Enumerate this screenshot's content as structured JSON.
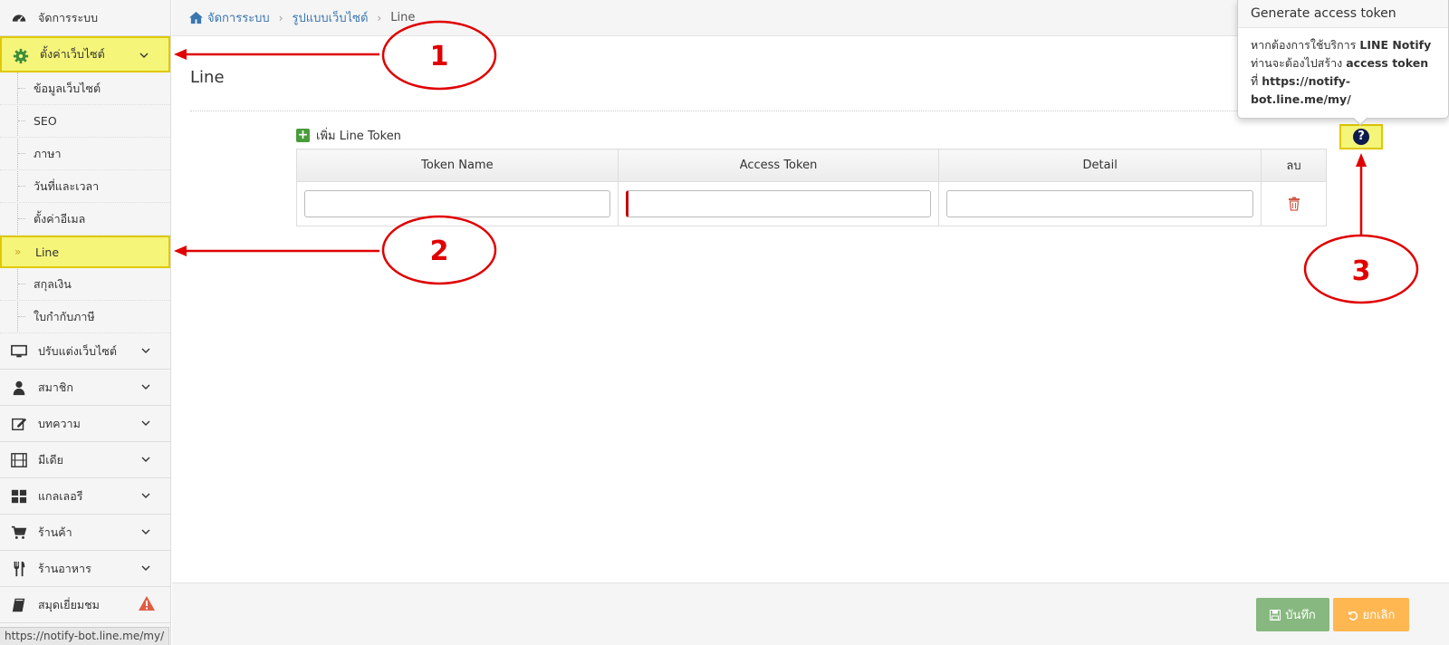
{
  "sidebar": {
    "items": [
      {
        "label": "จัดการระบบ",
        "icon": "dashboard-icon"
      },
      {
        "label": "ตั้งค่าเว็บไซต์",
        "icon": "gear-icon",
        "active": true
      },
      {
        "label": "ปรับแต่งเว็บไซต์",
        "icon": "monitor-icon"
      },
      {
        "label": "สมาชิก",
        "icon": "user-icon"
      },
      {
        "label": "บทความ",
        "icon": "edit-icon"
      },
      {
        "label": "มีเดีย",
        "icon": "film-icon"
      },
      {
        "label": "แกลเลอรี",
        "icon": "grid-icon"
      },
      {
        "label": "ร้านค้า",
        "icon": "cart-icon"
      },
      {
        "label": "ร้านอาหาร",
        "icon": "cutlery-icon"
      },
      {
        "label": "สมุดเยี่ยมชม",
        "icon": "book-icon",
        "badge": "warning-icon"
      }
    ],
    "sub_items": [
      {
        "label": "ข้อมูลเว็บไซต์"
      },
      {
        "label": "SEO"
      },
      {
        "label": "ภาษา"
      },
      {
        "label": "วันที่และเวลา"
      },
      {
        "label": "ตั้งค่าอีเมล"
      },
      {
        "label": "Line",
        "active": true,
        "marker": "»"
      },
      {
        "label": "สกุลเงิน"
      },
      {
        "label": "ใบกำกับภาษี"
      }
    ]
  },
  "breadcrumb": {
    "home": "จัดการระบบ",
    "section": "รูปแบบเว็บไซต์",
    "current": "Line",
    "separator": "›"
  },
  "page": {
    "title": "Line",
    "add_token_label": "เพิ่ม Line Token"
  },
  "table": {
    "headers": [
      "Token Name",
      "Access Token",
      "Detail",
      "ลบ"
    ],
    "rows": [
      {
        "token_name": "",
        "access_token": "",
        "detail": ""
      }
    ]
  },
  "popover": {
    "title": "Generate access token",
    "line1_pre": "หากต้องการใช้บริการ ",
    "line1_bold": "LINE Notify",
    "line2_pre": "ท่านจะต้องไปสร้าง ",
    "line2_bold": "access token",
    "line3_pre": "ที่ ",
    "line3_bold": "https://notify-",
    "line4_bold": "bot.line.me/my/"
  },
  "help_button": {
    "glyph": "?"
  },
  "footer": {
    "save_label": "บันทึก",
    "cancel_label": "ยกเลิก"
  },
  "statusbar": {
    "url": "https://notify-bot.line.me/my/"
  },
  "annotations": {
    "labels": [
      "1",
      "2",
      "3"
    ],
    "color": "#e00000"
  },
  "colors": {
    "highlight": "#f5f57a",
    "link": "#3a76b0",
    "save": "#87b87f",
    "cancel": "#ffb752",
    "add_icon": "#4a9b3c"
  }
}
